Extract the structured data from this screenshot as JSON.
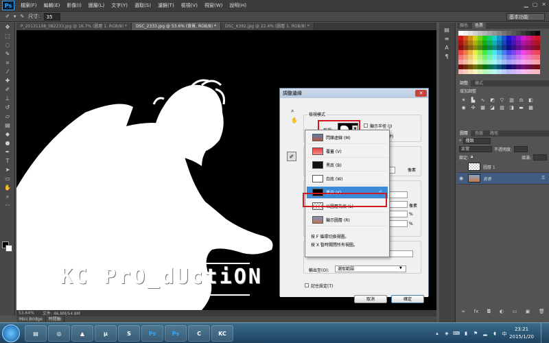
{
  "app": {
    "logo": "Ps"
  },
  "menus": [
    "檔案(F)",
    "編輯(E)",
    "影像(I)",
    "圖層(L)",
    "文字(Y)",
    "選取(S)",
    "濾鏡(T)",
    "檢視(V)",
    "視窗(W)",
    "說明(H)"
  ],
  "options_bar": {
    "size_label": "尺寸:",
    "size_value": "35",
    "workspace": "基本功能"
  },
  "doc_tabs": [
    "P_20131108_082233.jpg @ 16.7% (圖層 1, RGB/8) *",
    "DSC_2333.jpg @ 53.6% (背景, RGB/8) *",
    "DSC_6392.jpg @ 22.4% (圖層 1, RGB/8) *"
  ],
  "canvas": {
    "watermark": "KC PrO_dUctiON"
  },
  "status": {
    "zoom": "53.64%",
    "doc": "文件: 46.8M/54.8M"
  },
  "bottom_tabs": [
    "Mini Bridge",
    "時間軸"
  ],
  "panels": {
    "swatches_tabs": [
      "顏色",
      "色票"
    ],
    "adjust_tabs": [
      "調整",
      "樣式"
    ],
    "adjust_title": "增加調整",
    "layers_tabs": [
      "圖層",
      "色版",
      "路徑"
    ],
    "kind": "種類",
    "blend": "正常",
    "opacity_label": "不透明度:",
    "lock_label": "鎖定:",
    "fill_label": "填滿:",
    "layers": [
      {
        "name": "圖層 1",
        "selected": false
      },
      {
        "name": "背景",
        "selected": true
      }
    ]
  },
  "dialog": {
    "title": "調整邊緣",
    "view_mode_group": "檢視模式",
    "view_label": "檢視:",
    "show_radius": "顯示半徑 (J)",
    "show_original": "顯示原始 (P)",
    "unit_px_1": "像素",
    "unit_px_2": "像素",
    "unit_pct_1": "%",
    "unit_pct_2": "%",
    "output_to": "輸出至(O):",
    "output_value": "選取範圍",
    "remember": "記住設定(T)",
    "cancel": "取消",
    "ok": "確定"
  },
  "dropdown": {
    "items": [
      {
        "label": "閃爍虛線 (M)",
        "thumb": "photo",
        "selected": false
      },
      {
        "label": "覆蓋 (V)",
        "thumb": "red",
        "selected": false
      },
      {
        "label": "黑底 (B)",
        "thumb": "black",
        "selected": false
      },
      {
        "label": "白底 (W)",
        "thumb": "white",
        "selected": false
      },
      {
        "label": "黑白 (K)",
        "thumb": "bw",
        "selected": true
      },
      {
        "label": "以圖層為底 (L)",
        "thumb": "checker",
        "selected": false
      },
      {
        "label": "顯示圖層 (R)",
        "thumb": "photo",
        "selected": false
      }
    ],
    "hint1": "按 F 循環切換視圖。",
    "hint2": "按 X 暫時關閉所有視圖。"
  },
  "taskbar": {
    "time": "23:21",
    "date": "2015/1/20",
    "apps": [
      "explorer",
      "chrome",
      "vlc",
      "utorrent",
      "skype",
      "photoshop",
      "photoshop-2",
      "helper",
      "kc"
    ]
  }
}
